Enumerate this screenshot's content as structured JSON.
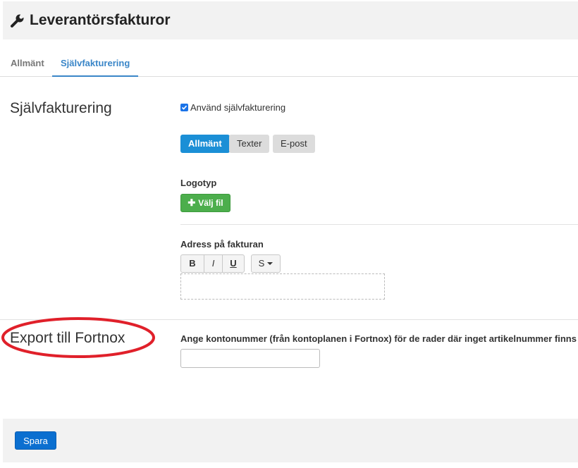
{
  "header": {
    "title": "Leverantörsfakturor",
    "icon": "wrench-icon"
  },
  "tabs": [
    {
      "label": "Allmänt",
      "active": false
    },
    {
      "label": "Självfakturering",
      "active": true
    }
  ],
  "self_billing": {
    "section_title": "Självfakturering",
    "checkbox_label": "Använd självfakturering",
    "checkbox_checked": true,
    "subtabs": [
      {
        "label": "Allmänt",
        "active": true
      },
      {
        "label": "Texter",
        "active": false
      },
      {
        "label": "E-post",
        "active": false
      }
    ],
    "logo_label": "Logotyp",
    "choose_file_label": "Välj fil",
    "address_label": "Adress på fakturan",
    "editor": {
      "bold": "B",
      "italic": "I",
      "underline": "U",
      "style": "S"
    }
  },
  "fortnox": {
    "section_title": "Export till Fortnox",
    "account_label": "Ange kontonummer (från kontoplanen i Fortnox) för de rader där inget artikelnummer finns",
    "account_value": ""
  },
  "footer": {
    "save_label": "Spara"
  },
  "colors": {
    "accent": "#3a86c8",
    "primary_button": "#0b6fd0",
    "success_button": "#4cae4c",
    "annotation": "#e0202a"
  }
}
